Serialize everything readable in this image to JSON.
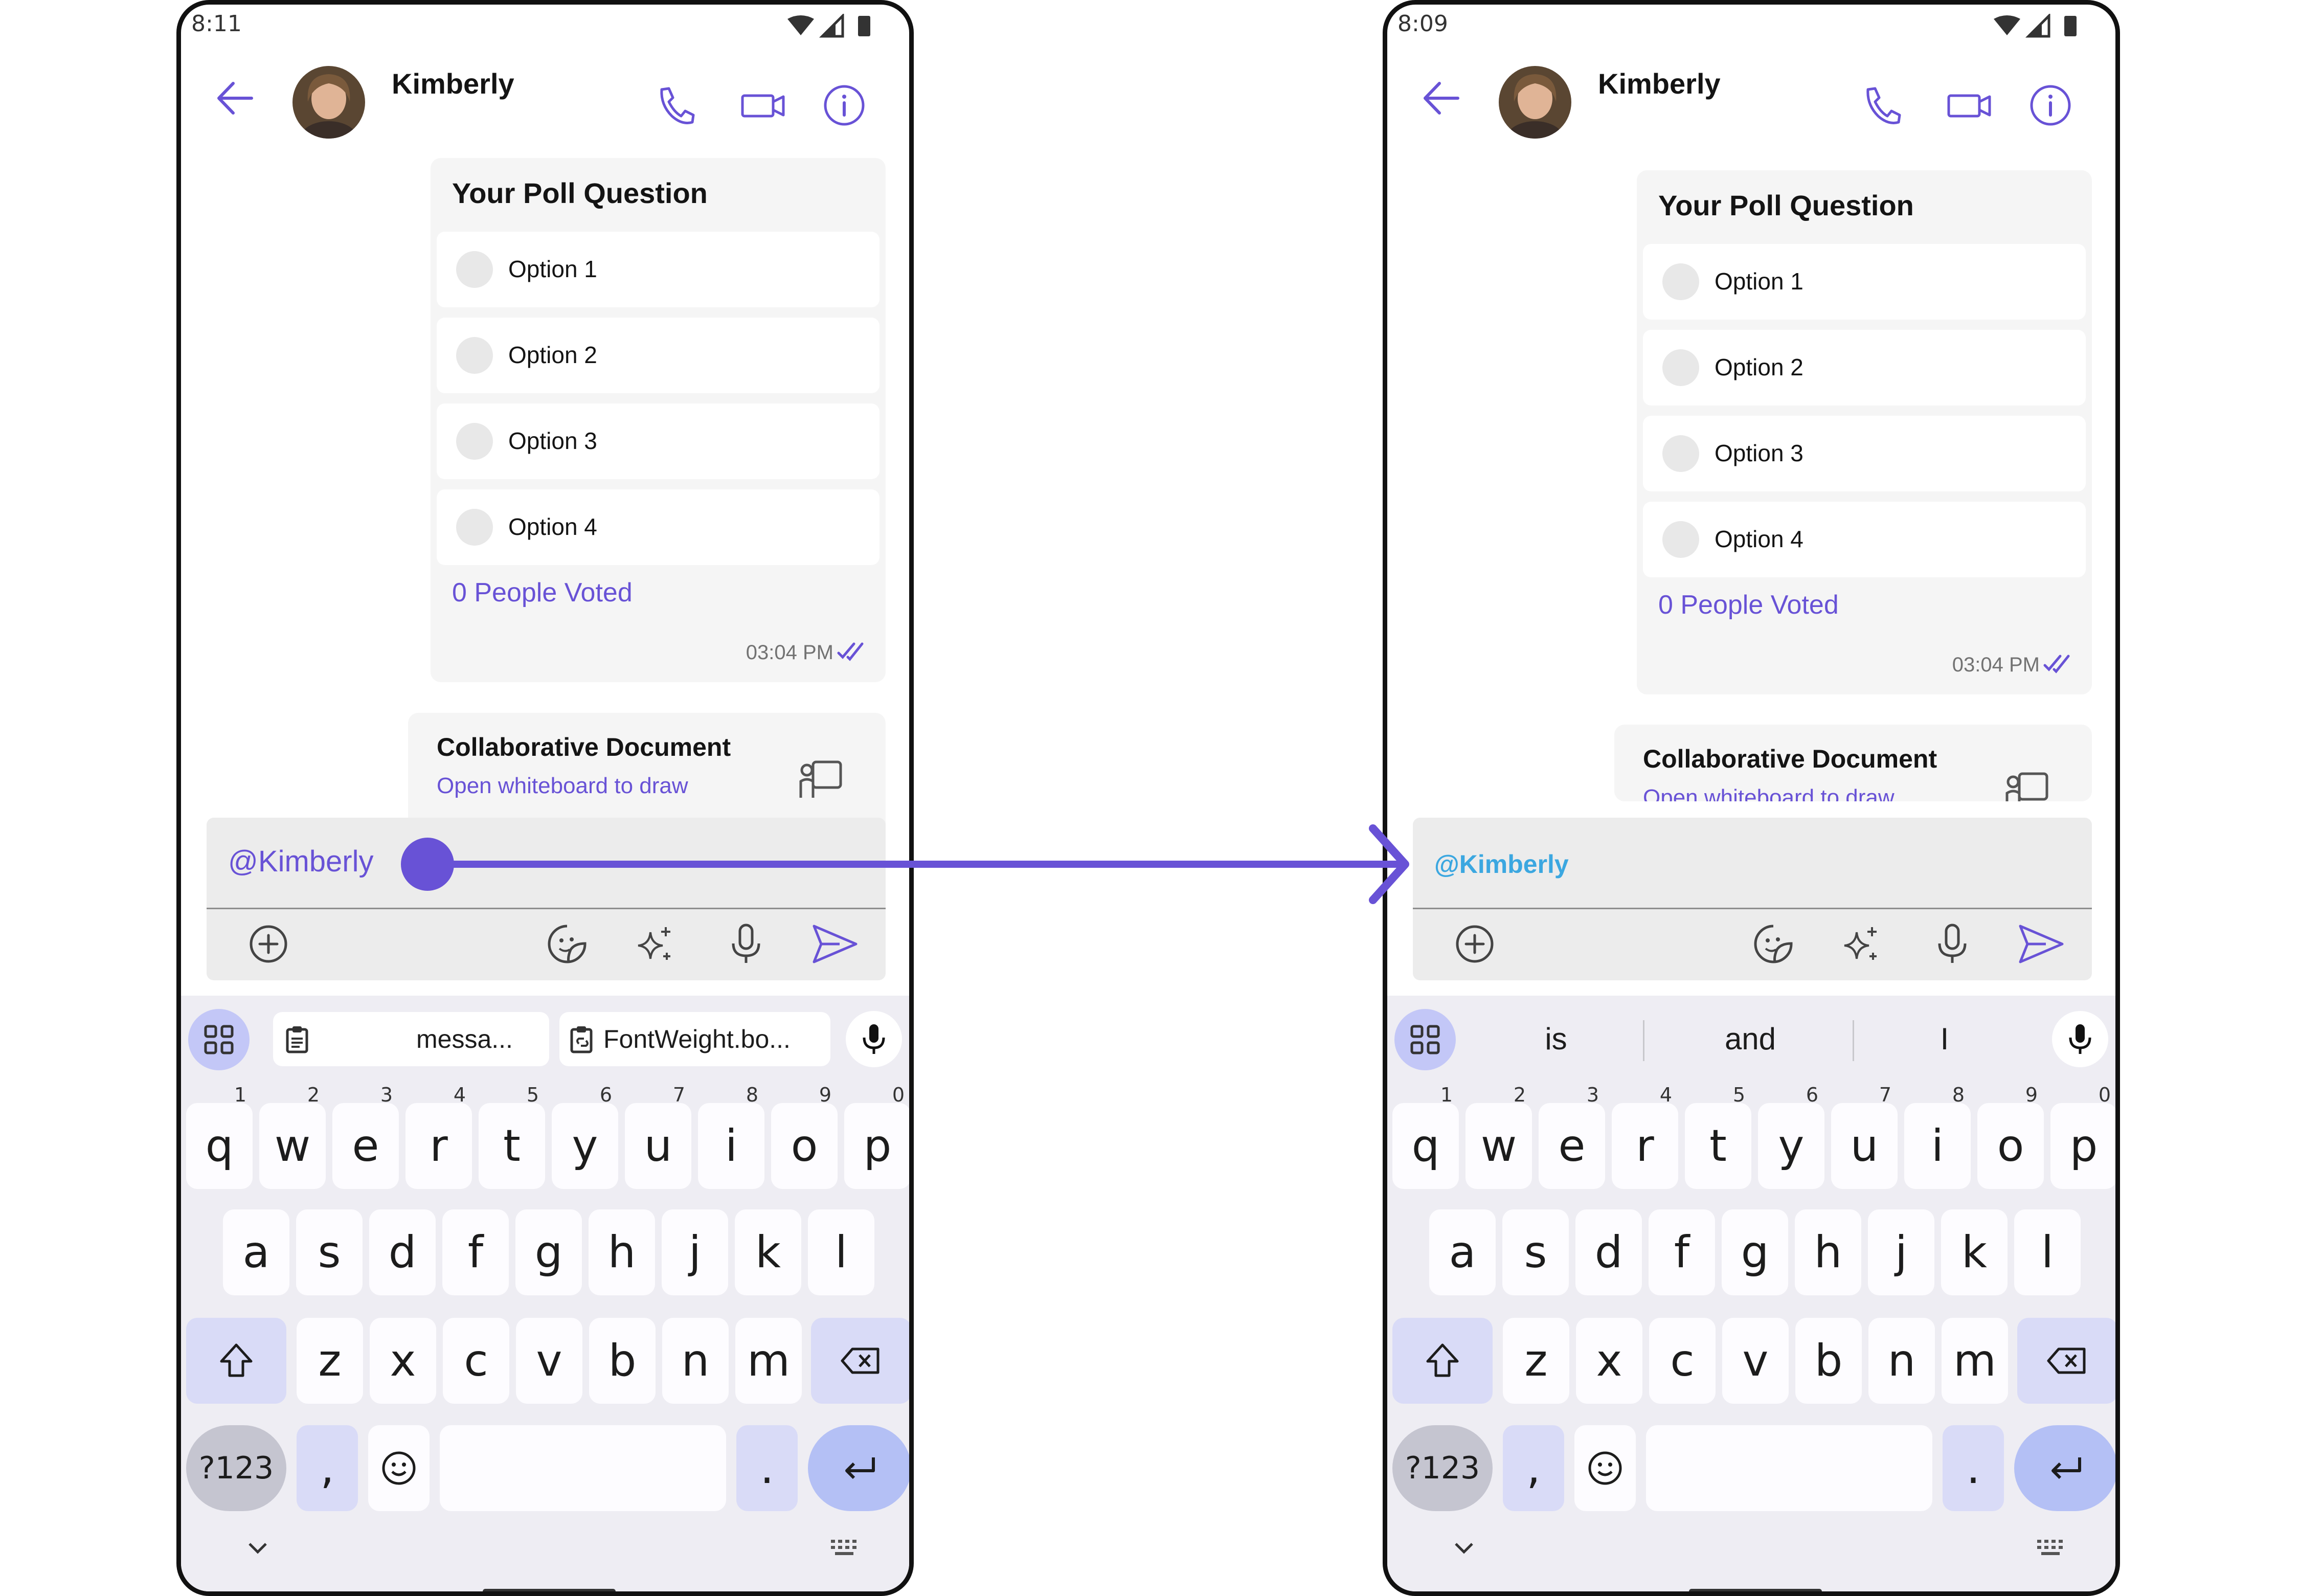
{
  "accent_color": "#6852d6",
  "screens": [
    {
      "status_time": "8:11",
      "header": {
        "contact_name": "Kimberly"
      },
      "poll": {
        "question": "Your Poll Question",
        "options": [
          "Option 1",
          "Option 2",
          "Option 3",
          "Option 4"
        ],
        "votes": "0 People Voted",
        "time": "03:04 PM"
      },
      "collab": {
        "title": "Collaborative Document",
        "subtitle": "Open whiteboard to draw"
      },
      "composer": {
        "text": "@Kimberly"
      },
      "keyboard": {
        "suggestions": [
          "messa...",
          "FontWeight.bo..."
        ]
      }
    },
    {
      "status_time": "8:09",
      "header": {
        "contact_name": "Kimberly"
      },
      "poll": {
        "question": "Your Poll Question",
        "options": [
          "Option 1",
          "Option 2",
          "Option 3",
          "Option 4"
        ],
        "votes": "0 People Voted",
        "time": "03:04 PM"
      },
      "collab": {
        "title": "Collaborative Document",
        "subtitle": "Open whiteboard to draw"
      },
      "composer": {
        "text": "@Kimberly"
      },
      "keyboard": {
        "suggestions": [
          "is",
          "and",
          "I"
        ]
      }
    }
  ],
  "keys": {
    "row1": [
      "q",
      "w",
      "e",
      "r",
      "t",
      "y",
      "u",
      "i",
      "o",
      "p"
    ],
    "row1_hints": [
      "1",
      "2",
      "3",
      "4",
      "5",
      "6",
      "7",
      "8",
      "9",
      "0"
    ],
    "row2": [
      "a",
      "s",
      "d",
      "f",
      "g",
      "h",
      "j",
      "k",
      "l"
    ],
    "row3": [
      "z",
      "x",
      "c",
      "v",
      "b",
      "n",
      "m"
    ],
    "symbols": "?123",
    "comma": ",",
    "period": "."
  }
}
